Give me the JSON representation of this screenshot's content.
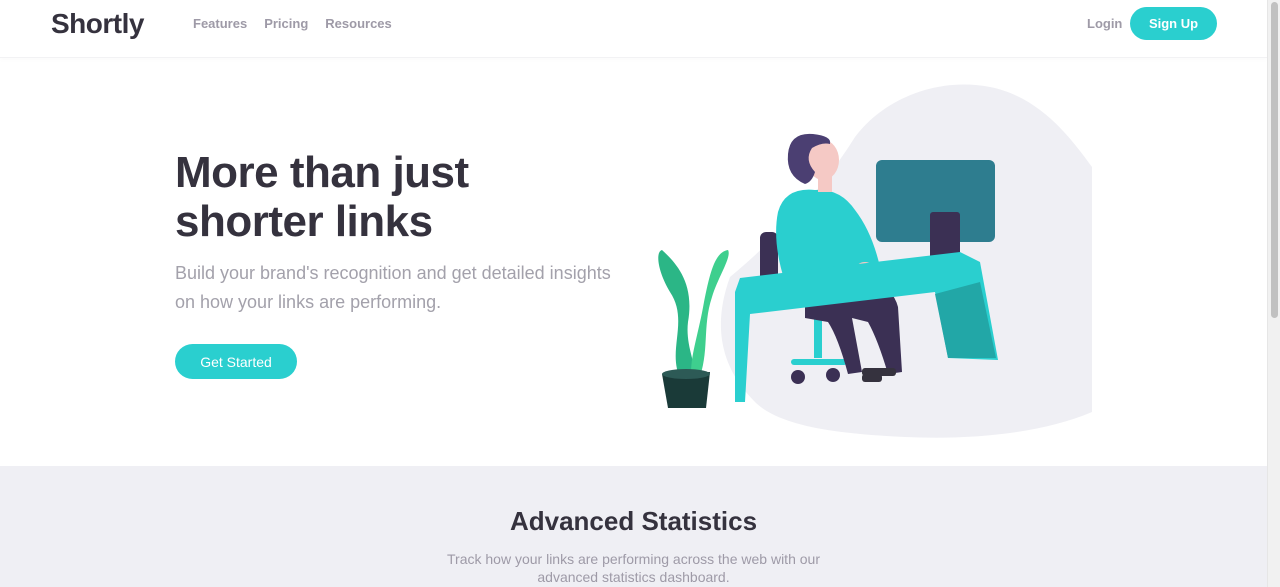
{
  "header": {
    "logo": "Shortly",
    "nav": [
      "Features",
      "Pricing",
      "Resources"
    ],
    "login": "Login",
    "signup": "Sign Up"
  },
  "hero": {
    "title": "More than just shorter links",
    "subtitle": "Build your brand's recognition and get detailed insights on how your links are performing.",
    "cta": "Get Started"
  },
  "stats": {
    "title": "Advanced Statistics",
    "description": "Track how your links are performing across the web with our advanced statistics dashboard."
  },
  "colors": {
    "primary": "#2acfcf",
    "dark": "#35323e",
    "gray": "#9e9aa7",
    "section_bg": "#efeff4"
  }
}
